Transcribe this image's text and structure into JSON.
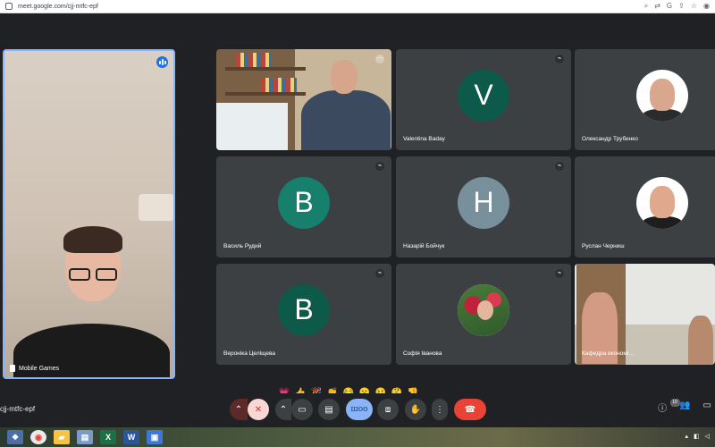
{
  "browser": {
    "url": "meet.google.com/cjj-mtfc-epf",
    "icons": [
      "search-icon",
      "translate-icon",
      "g-icon",
      "share-icon",
      "star-icon",
      "extension-icon"
    ]
  },
  "self_view": {
    "name": "Mobile Games"
  },
  "participants": [
    {
      "name": "",
      "type": "video"
    },
    {
      "name": "Valentina Baday",
      "type": "letter",
      "letter": "V",
      "color": "#0d5a4a"
    },
    {
      "name": "Олександр Трубенко",
      "type": "photo"
    },
    {
      "name": "Василь Рудий",
      "type": "letter",
      "letter": "В",
      "color": "#16806d"
    },
    {
      "name": "Назарій Бойчук",
      "type": "letter",
      "letter": "Н",
      "color": "#78909c"
    },
    {
      "name": "Руслан Черниш",
      "type": "photo"
    },
    {
      "name": "Вероніка Целіщева",
      "type": "letter",
      "letter": "В",
      "color": "#0d5a4a"
    },
    {
      "name": "Софія Іванова",
      "type": "photo"
    },
    {
      "name": "Кафедра економі…",
      "type": "video"
    }
  ],
  "reactions": [
    "💗",
    "👍",
    "🎉",
    "👏",
    "😂",
    "😮",
    "😢",
    "🤔",
    "👎"
  ],
  "controls": {
    "meeting_code": "cjj-mtfc-epf",
    "screen_label": "шоо"
  },
  "participant_count": "10",
  "colors": {
    "background": "#202124",
    "tile": "#3c4043",
    "leave": "#ea4335",
    "active_outline": "#8ab4f8"
  }
}
